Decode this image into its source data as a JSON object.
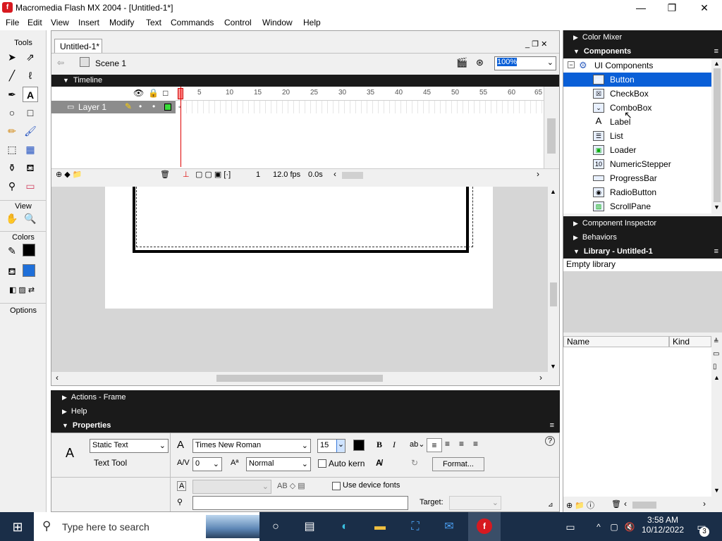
{
  "window": {
    "title": "Macromedia Flash MX 2004 - [Untitled-1*]",
    "icon": "flash-app-icon",
    "minimize": "—",
    "restore": "❐",
    "close": "✕"
  },
  "menu": [
    "File",
    "Edit",
    "View",
    "Insert",
    "Modify",
    "Text",
    "Commands",
    "Control",
    "Window",
    "Help"
  ],
  "tools": {
    "title": "Tools",
    "view": "View",
    "colors": "Colors",
    "options": "Options"
  },
  "document": {
    "tab": "Untitled-1*",
    "scene": "Scene 1",
    "zoom": "100%",
    "timeline_label": "Timeline",
    "layer_name": "Layer 1",
    "ruler": [
      "5",
      "10",
      "15",
      "20",
      "25",
      "30",
      "35",
      "40",
      "45",
      "50",
      "55",
      "60",
      "65"
    ],
    "frame": "1",
    "fps": "12.0 fps",
    "time": "0.0s"
  },
  "panels": {
    "actions": "Actions - Frame",
    "help": "Help",
    "properties": "Properties"
  },
  "properties": {
    "text_type": "Static Text",
    "tool_label": "Text Tool",
    "font": "Times New Roman",
    "size": "15",
    "tracking": "0",
    "kerning_style": "Normal",
    "auto_kern": "Auto kern",
    "format_button": "Format...",
    "use_device_fonts": "Use device fonts",
    "target_label": "Target:"
  },
  "right_panel": {
    "color_mixer": "Color Mixer",
    "components": "Components",
    "ui_components": "UI Components",
    "items": [
      "Button",
      "CheckBox",
      "ComboBox",
      "Label",
      "List",
      "Loader",
      "NumericStepper",
      "ProgressBar",
      "RadioButton",
      "ScrollPane"
    ],
    "component_inspector": "Component Inspector",
    "behaviors": "Behaviors",
    "library": "Library - Untitled-1",
    "empty_library": "Empty library",
    "col_name": "Name",
    "col_kind": "Kind"
  },
  "taskbar": {
    "search_placeholder": "Type here to search",
    "time": "3:58 AM",
    "date": "10/12/2022",
    "notifications": "3"
  }
}
